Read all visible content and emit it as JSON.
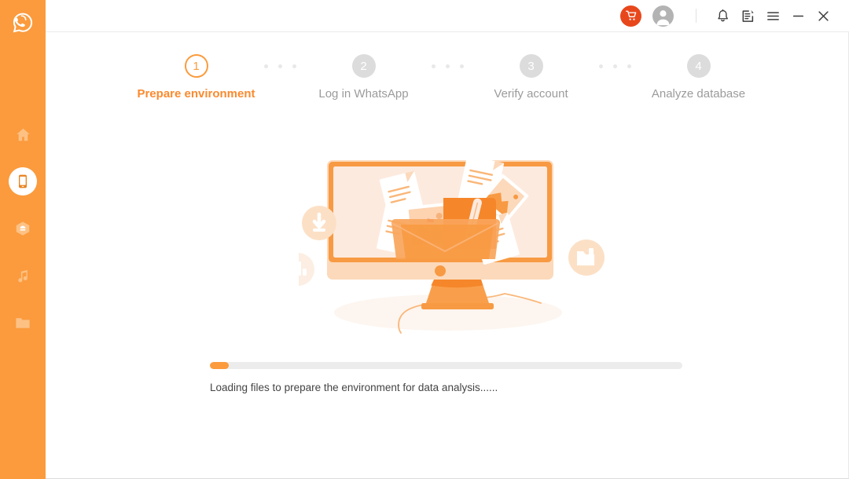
{
  "app": {
    "brand_icon": "whatsapp-logo-icon",
    "accent_color": "#fb9b3d",
    "accent_text_color": "#fb8a2e",
    "cart_color": "#e8471c",
    "idle_color": "#dcdcdc",
    "idle_text_color": "#9b9b9b"
  },
  "sidebar": {
    "items": [
      {
        "icon": "home-icon",
        "name": "home",
        "active": false
      },
      {
        "icon": "phone-icon",
        "name": "phone-transfer",
        "active": true
      },
      {
        "icon": "cloud-icon",
        "name": "cloud-backup",
        "active": false
      },
      {
        "icon": "music-icon",
        "name": "music-manager",
        "active": false
      },
      {
        "icon": "folder-icon",
        "name": "file-explorer",
        "active": false
      }
    ]
  },
  "titlebar": {
    "cart_icon": "shopping-cart-icon",
    "avatar_icon": "user-avatar-icon",
    "notification_icon": "bell-icon",
    "feedback_icon": "feedback-note-icon",
    "menu_icon": "hamburger-menu-icon",
    "minimize_icon": "minimize-icon",
    "close_icon": "close-icon"
  },
  "steps": [
    {
      "number": "1",
      "label": "Prepare environment",
      "state": "active"
    },
    {
      "number": "2",
      "label": "Log in WhatsApp",
      "state": "idle"
    },
    {
      "number": "3",
      "label": "Verify account",
      "state": "idle"
    },
    {
      "number": "4",
      "label": "Analyze database",
      "state": "idle"
    }
  ],
  "illustration": {
    "name": "computer-data-transfer-illustration",
    "badges": [
      {
        "name": "download-badge-icon"
      },
      {
        "name": "bar-chart-badge-icon"
      },
      {
        "name": "folder-badge-icon"
      }
    ]
  },
  "progress": {
    "percent": 4,
    "status_text": "Loading files to prepare the environment for data analysis......"
  }
}
